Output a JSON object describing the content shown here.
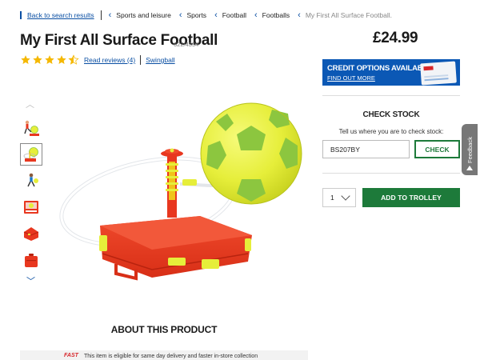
{
  "breadcrumb": {
    "back": "Back to search results",
    "items": [
      "Sports and leisure",
      "Sports",
      "Football",
      "Footballs"
    ],
    "current": "My First All Surface Football."
  },
  "product": {
    "title": "My First All Surface Football",
    "code": "622/4354",
    "rating": 4.5,
    "reviews": "Read reviews (4)",
    "brand": "Swingball",
    "price": "£24.99"
  },
  "credit": {
    "title": "CREDIT OPTIONS AVAILABLE",
    "link": "FIND OUT MORE"
  },
  "stock": {
    "title": "CHECK STOCK",
    "label": "Tell us where you are to check stock:",
    "postcode": "BS207BY",
    "button": "CHECK"
  },
  "purchase": {
    "quantity": "1",
    "add_button": "ADD TO TROLLEY"
  },
  "feedback": "Feedback",
  "about": "ABOUT THIS PRODUCT",
  "banner": {
    "logo": "FAST",
    "text": "This item is eligible for same day delivery and faster in-store collection"
  },
  "colors": {
    "brand_blue": "#0b58b5",
    "link_blue": "#0a4fa3",
    "action_green": "#1d7a3a",
    "ball_yellow": "#e6ee3a",
    "ball_green": "#8cc63f",
    "base_red": "#e8371f",
    "star_gold": "#f5b800"
  },
  "thumbnails": [
    {
      "name": "thumb-boy-kicking-ball",
      "active": false
    },
    {
      "name": "thumb-football-on-base",
      "active": true
    },
    {
      "name": "thumb-child-playing",
      "active": false
    },
    {
      "name": "thumb-packaging-box",
      "active": false
    },
    {
      "name": "thumb-red-base",
      "active": false
    },
    {
      "name": "thumb-red-case",
      "active": false
    }
  ]
}
